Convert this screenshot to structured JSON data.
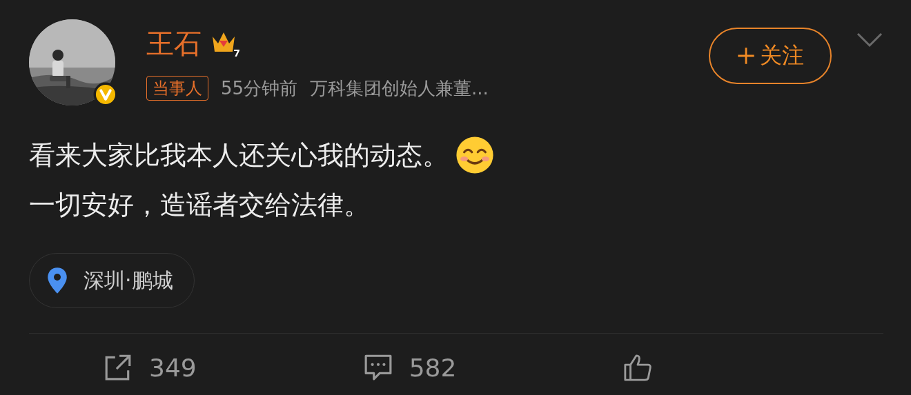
{
  "post": {
    "author": "王石",
    "level_badge": "7",
    "tag": "当事人",
    "time": "55分钟前",
    "bio": "万科集团创始人兼董...",
    "follow_button": "关注",
    "lines": [
      "看来大家比我本人还关心我的动态。",
      "一切安好，造谣者交给法律。"
    ],
    "location": "深圳·鹏城"
  },
  "actions": [
    {
      "kind": "share",
      "count": "349"
    },
    {
      "kind": "comment",
      "count": "582"
    },
    {
      "kind": "like"
    }
  ]
}
